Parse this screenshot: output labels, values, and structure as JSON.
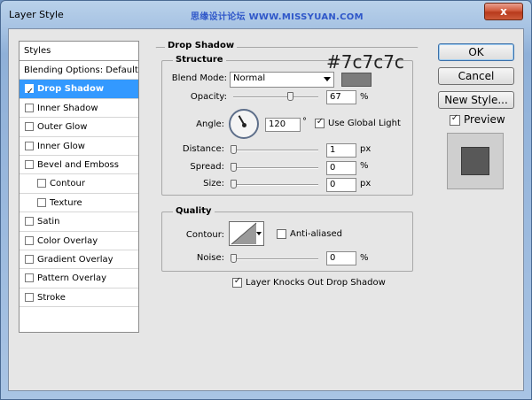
{
  "window": {
    "title": "Layer Style",
    "watermark": "思缘设计论坛 WWW.MISSYUAN.COM",
    "close_label": "x"
  },
  "styles_list": {
    "header": "Styles",
    "items": [
      {
        "label": "Blending Options: Default",
        "checkbox": false,
        "checked": false,
        "indent": false,
        "selected": false
      },
      {
        "label": "Drop Shadow",
        "checkbox": true,
        "checked": true,
        "indent": false,
        "selected": true
      },
      {
        "label": "Inner Shadow",
        "checkbox": true,
        "checked": false,
        "indent": false,
        "selected": false
      },
      {
        "label": "Outer Glow",
        "checkbox": true,
        "checked": false,
        "indent": false,
        "selected": false
      },
      {
        "label": "Inner Glow",
        "checkbox": true,
        "checked": false,
        "indent": false,
        "selected": false
      },
      {
        "label": "Bevel and Emboss",
        "checkbox": true,
        "checked": false,
        "indent": false,
        "selected": false
      },
      {
        "label": "Contour",
        "checkbox": true,
        "checked": false,
        "indent": true,
        "selected": false
      },
      {
        "label": "Texture",
        "checkbox": true,
        "checked": false,
        "indent": true,
        "selected": false
      },
      {
        "label": "Satin",
        "checkbox": true,
        "checked": false,
        "indent": false,
        "selected": false
      },
      {
        "label": "Color Overlay",
        "checkbox": true,
        "checked": false,
        "indent": false,
        "selected": false
      },
      {
        "label": "Gradient Overlay",
        "checkbox": true,
        "checked": false,
        "indent": false,
        "selected": false
      },
      {
        "label": "Pattern Overlay",
        "checkbox": true,
        "checked": false,
        "indent": false,
        "selected": false
      },
      {
        "label": "Stroke",
        "checkbox": true,
        "checked": false,
        "indent": false,
        "selected": false
      }
    ]
  },
  "drop_shadow": {
    "title": "Drop Shadow",
    "structure": {
      "title": "Structure",
      "blend_mode_label": "Blend Mode:",
      "blend_mode_value": "Normal",
      "color_hex": "#7c7c7c",
      "color_annotation": "#7c7c7c",
      "opacity_label": "Opacity:",
      "opacity_value": "67",
      "opacity_percent": 67,
      "opacity_unit": "%",
      "angle_label": "Angle:",
      "angle_value": "120",
      "angle_unit": "°",
      "use_global_light_label": "Use Global Light",
      "use_global_light_checked": true,
      "distance_label": "Distance:",
      "distance_value": "1",
      "distance_unit": "px",
      "distance_fraction": 0.0,
      "spread_label": "Spread:",
      "spread_value": "0",
      "spread_unit": "%",
      "size_label": "Size:",
      "size_value": "0",
      "size_unit": "px"
    },
    "quality": {
      "title": "Quality",
      "contour_label": "Contour:",
      "anti_aliased_label": "Anti-aliased",
      "anti_aliased_checked": false,
      "noise_label": "Noise:",
      "noise_value": "0",
      "noise_unit": "%"
    },
    "layer_knocks_out_label": "Layer Knocks Out Drop Shadow",
    "layer_knocks_out_checked": true
  },
  "buttons": {
    "ok": "OK",
    "cancel": "Cancel",
    "new_style": "New Style..."
  },
  "preview": {
    "label": "Preview",
    "checked": true,
    "swatch_color": "#585858"
  }
}
